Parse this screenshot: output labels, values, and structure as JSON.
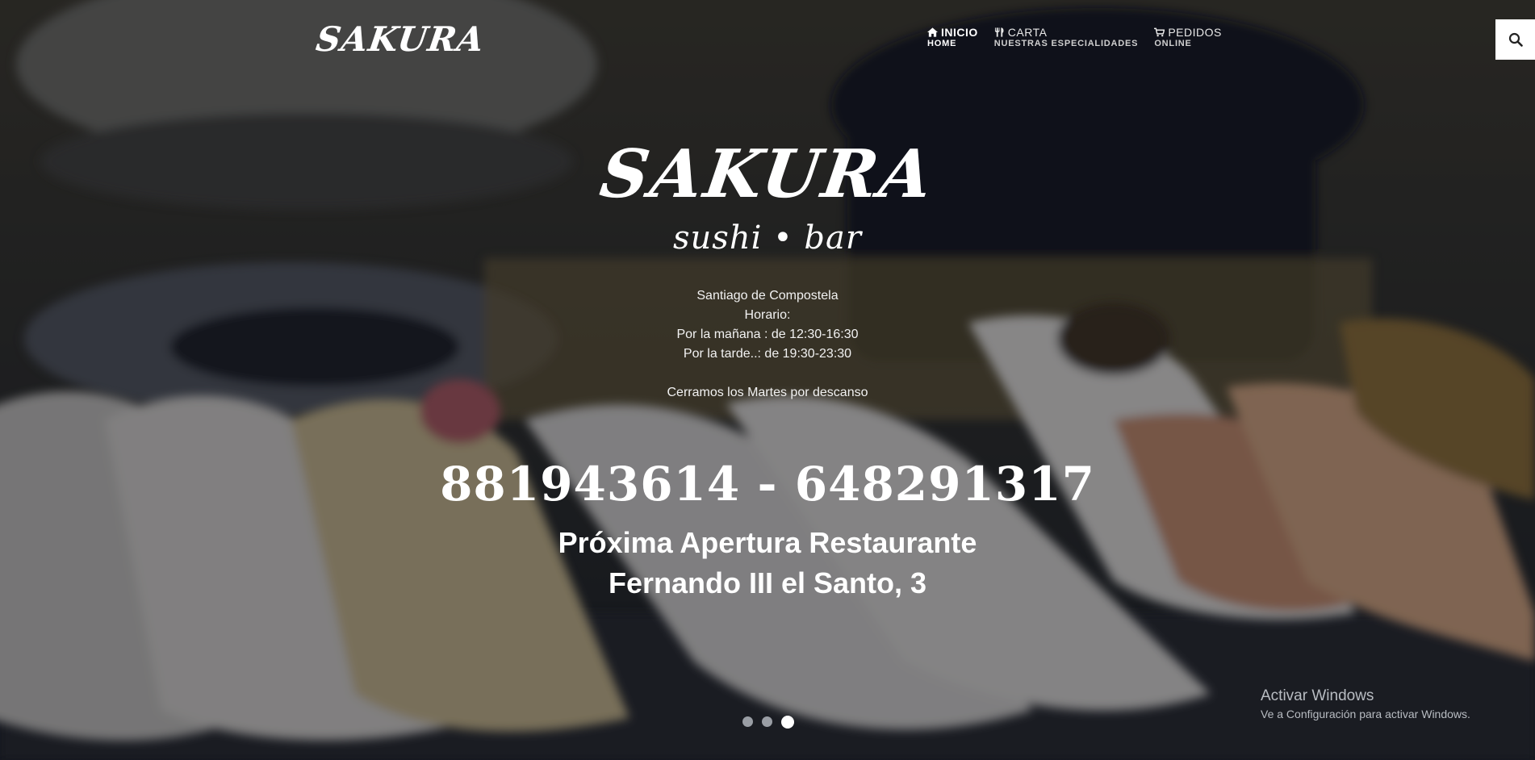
{
  "header": {
    "logo": "SAKURA",
    "nav": [
      {
        "icon": "home-icon",
        "label": "INICIO",
        "sub": "HOME"
      },
      {
        "icon": "cutlery-icon",
        "label": "CARTA",
        "sub": "NUESTRAS ESPECIALIDADES"
      },
      {
        "icon": "cart-icon",
        "label": "PEDIDOS",
        "sub": "ONLINE"
      }
    ],
    "search_icon": "search-icon"
  },
  "hero": {
    "brand": "SAKURA",
    "tagline": "sushi • bar",
    "info": {
      "city": "Santiago de Compostela",
      "hours_title": "Horario:",
      "morning": "Por la mañana : de 12:30-16:30",
      "afternoon": "Por la tarde..: de 19:30-23:30",
      "closed": "Cerramos los Martes por descanso"
    },
    "phones": "881943614 - 648291317",
    "opening_line1": "Próxima Apertura Restaurante",
    "opening_line2": "Fernando III el Santo, 3"
  },
  "slider": {
    "count": 3,
    "active": 3
  },
  "watermark": {
    "title": "Activar Windows",
    "subtitle": "Ve a Configuración para activar Windows."
  }
}
